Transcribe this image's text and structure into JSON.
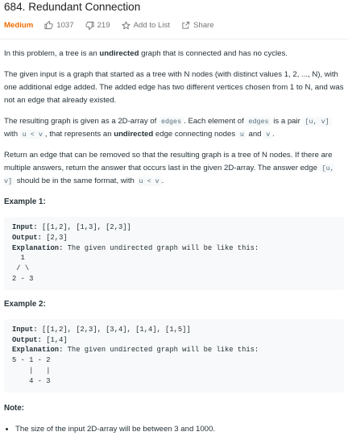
{
  "problem": {
    "title": "684. Redundant Connection",
    "difficulty": "Medium",
    "likes": "1037",
    "dislikes": "219",
    "add_to_list": "Add to List",
    "share": "Share"
  },
  "description": {
    "p1_a": "In this problem, a tree is an ",
    "p1_b": "undirected",
    "p1_c": " graph that is connected and has no cycles.",
    "p2": "The given input is a graph that started as a tree with N nodes (with distinct values 1, 2, ..., N), with one additional edge added. The added edge has two different vertices chosen from 1 to N, and was not an edge that already existed.",
    "p3_a": "The resulting graph is given as a 2D-array of ",
    "p3_code1": "edges",
    "p3_b": ". Each element of ",
    "p3_code2": "edges",
    "p3_c": " is a pair ",
    "p3_code3": "[u, v]",
    "p3_d": " with ",
    "p3_code4": "u < v",
    "p3_e": ", that represents an ",
    "p3_f": "undirected",
    "p3_g": " edge connecting nodes ",
    "p3_code5": "u",
    "p3_h": " and ",
    "p3_code6": "v",
    "p3_i": ".",
    "p4_a": "Return an edge that can be removed so that the resulting graph is a tree of N nodes. If there are multiple answers, return the answer that occurs last in the given 2D-array. The answer edge ",
    "p4_code1": "[u, v]",
    "p4_b": " should be in the same format, with ",
    "p4_code2": "u < v",
    "p4_c": "."
  },
  "example1": {
    "title": "Example 1:",
    "input_label": "Input:",
    "input": " [[1,2], [1,3], [2,3]]",
    "output_label": "Output:",
    "output": " [2,3]",
    "explanation_label": "Explanation:",
    "explanation": " The given undirected graph will be like this:",
    "graph": "  1\n / \\\n2 - 3"
  },
  "example2": {
    "title": "Example 2:",
    "input_label": "Input:",
    "input": " [[1,2], [2,3], [3,4], [1,4], [1,5]]",
    "output_label": "Output:",
    "output": " [1,4]",
    "explanation_label": "Explanation:",
    "explanation": " The given undirected graph will be like this:",
    "graph": "5 - 1 - 2\n    |   |\n    4 - 3"
  },
  "note": {
    "title": "Note:",
    "items": [
      "The size of the input 2D-array will be between 3 and 1000."
    ]
  },
  "colors": {
    "difficulty": "#ef6c00",
    "code_bg": "#f7f9fa"
  },
  "icons": [
    "thumbs-up-icon",
    "thumbs-down-icon",
    "star-icon",
    "share-icon"
  ]
}
